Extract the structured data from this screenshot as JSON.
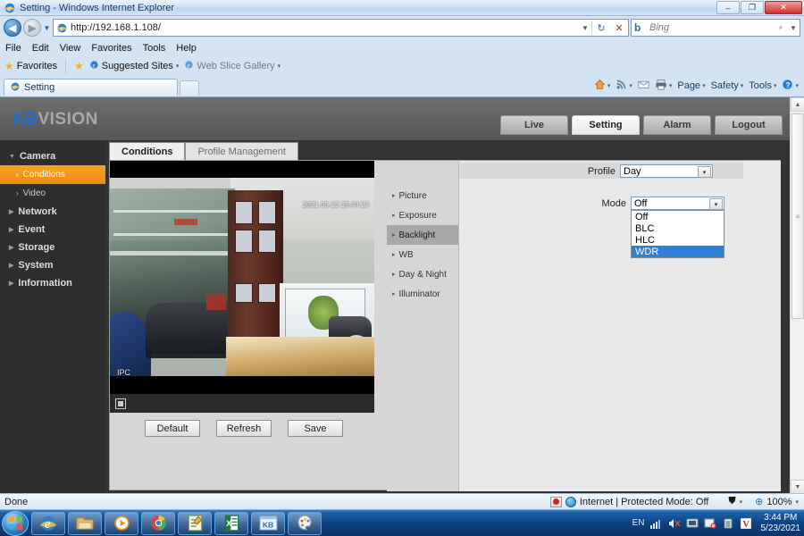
{
  "window": {
    "title": "Setting - Windows Internet Explorer",
    "minimize_label": "–",
    "maximize_label": "❐",
    "close_label": "✕"
  },
  "browser": {
    "back_label": "◀",
    "forward_label": "▶",
    "history_caret": "▼",
    "url": "http://192.168.1.108/",
    "url_caret": "▼",
    "refresh_icon": "↻",
    "stop_icon": "✕",
    "search_engine": "b",
    "search_placeholder": "Bing",
    "search_icon": "⌕",
    "search_caret": "▼",
    "menu": [
      "File",
      "Edit",
      "View",
      "Favorites",
      "Tools",
      "Help"
    ],
    "favorites": {
      "favorites_label": "Favorites",
      "suggested_sites": "Suggested Sites",
      "web_slice": "Web Slice Gallery",
      "caret": "▾"
    },
    "tab_label": "Setting",
    "command_bar": [
      {
        "label": "",
        "icon": "home-icon",
        "glyph": "⌂",
        "caret": true
      },
      {
        "label": "",
        "icon": "feeds-icon",
        "glyph": "◔",
        "caret": true
      },
      {
        "label": "",
        "icon": "read-mail-icon",
        "glyph": "✉",
        "caret": false
      },
      {
        "label": "",
        "icon": "print-icon",
        "glyph": "⎙",
        "caret": true
      },
      {
        "label": "Page",
        "icon": "page-menu",
        "glyph": "",
        "caret": true
      },
      {
        "label": "Safety",
        "icon": "safety-menu",
        "glyph": "",
        "caret": true
      },
      {
        "label": "Tools",
        "icon": "tools-menu",
        "glyph": "",
        "caret": true
      },
      {
        "label": "",
        "icon": "help-icon",
        "glyph": "?",
        "caret": true
      }
    ],
    "status": {
      "left": "Done",
      "zone": "Internet | Protected Mode: Off",
      "zoom": "100%",
      "zoom_icon": "⊕",
      "caret": "▾",
      "privacy_icon": "⛊"
    },
    "scrollbar": {
      "up_arrow": "▲",
      "down_arrow": "▼",
      "grip": "≡"
    }
  },
  "app": {
    "brand_kb": "KB",
    "brand_vision": "VISION",
    "nav_tabs": [
      {
        "label": "Live",
        "active": false
      },
      {
        "label": "Setting",
        "active": true
      },
      {
        "label": "Alarm",
        "active": false
      },
      {
        "label": "Logout",
        "active": false
      }
    ],
    "sidebar": [
      {
        "label": "Camera",
        "type": "group",
        "expanded": true,
        "marker": "▼"
      },
      {
        "label": "Conditions",
        "type": "child",
        "active": true,
        "marker": "›"
      },
      {
        "label": "Video",
        "type": "child",
        "active": false,
        "marker": "›"
      },
      {
        "label": "Network",
        "type": "group",
        "expanded": false,
        "marker": "▶"
      },
      {
        "label": "Event",
        "type": "group",
        "expanded": false,
        "marker": "▶"
      },
      {
        "label": "Storage",
        "type": "group",
        "expanded": false,
        "marker": "▶"
      },
      {
        "label": "System",
        "type": "group",
        "expanded": false,
        "marker": "▶"
      },
      {
        "label": "Information",
        "type": "group",
        "expanded": false,
        "marker": "▶"
      }
    ],
    "content_tabs": [
      {
        "label": "Conditions",
        "active": true
      },
      {
        "label": "Profile Management",
        "active": false
      }
    ],
    "video": {
      "timestamp": "2021-05-23 15:44:23",
      "channel_label": "IPC",
      "fullscreen_icon": "expand-icon"
    },
    "action_buttons": [
      "Default",
      "Refresh",
      "Save"
    ],
    "condition_menu": [
      {
        "label": "Picture",
        "active": false,
        "marker": "▸"
      },
      {
        "label": "Exposure",
        "active": false,
        "marker": "▸"
      },
      {
        "label": "Backlight",
        "active": true,
        "marker": "▸"
      },
      {
        "label": "WB",
        "active": false,
        "marker": "▸"
      },
      {
        "label": "Day & Night",
        "active": false,
        "marker": "▸"
      },
      {
        "label": "Illuminator",
        "active": false,
        "marker": "▸"
      }
    ],
    "profile": {
      "label": "Profile",
      "value": "Day",
      "caret": "▾"
    },
    "mode": {
      "label": "Mode",
      "value": "Off",
      "caret": "▾",
      "open": true,
      "options": [
        {
          "label": "Off",
          "selected": false
        },
        {
          "label": "BLC",
          "selected": false
        },
        {
          "label": "HLC",
          "selected": false
        },
        {
          "label": "WDR",
          "selected": true
        }
      ]
    }
  },
  "taskbar": {
    "start_label": "⊞",
    "buttons": [
      {
        "name": "internet-explorer",
        "glyph": "e"
      },
      {
        "name": "windows-explorer",
        "glyph": "Ὄ1"
      },
      {
        "name": "media-player",
        "glyph": "▶"
      },
      {
        "name": "google-chrome",
        "glyph": "◉"
      },
      {
        "name": "notepad",
        "glyph": "✎"
      },
      {
        "name": "excel",
        "glyph": "X"
      },
      {
        "name": "kb-app",
        "glyph": "KB"
      },
      {
        "name": "paint",
        "glyph": "⚘"
      }
    ],
    "tray": {
      "language": "EN",
      "network_icon": "▂",
      "volume_icon": "♫",
      "action_center_icon": "⚑",
      "antivirus_icon": "⛉",
      "battery_icon": "⬛",
      "v_icon": "V",
      "time": "3:44 PM",
      "date": "5/23/2021"
    }
  },
  "colors": {
    "accent_orange": "#ef8b0d",
    "brand_blue": "#1b6fd4",
    "select_blue": "#2d7fd8",
    "taskbar_blue": "#0c3f7c"
  }
}
